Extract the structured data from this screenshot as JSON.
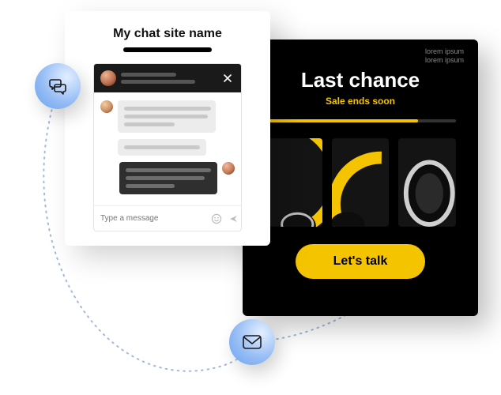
{
  "chat": {
    "site_name": "My chat site name",
    "input_placeholder": "Type a message"
  },
  "promo": {
    "lorem_line1": "lorem ipsum",
    "lorem_line2": "lorem ipsum",
    "title": "Last chance",
    "subtitle": "Sale ends soon",
    "cta": "Let's talk"
  },
  "colors": {
    "accent": "#f4c400",
    "badge_gradient_start": "#e3efff",
    "badge_gradient_end": "#6aa1ed"
  },
  "icons": {
    "chat": "chat-icon",
    "mail": "mail-icon",
    "emoji": "emoji-icon",
    "send": "send-icon",
    "close": "close-icon"
  }
}
